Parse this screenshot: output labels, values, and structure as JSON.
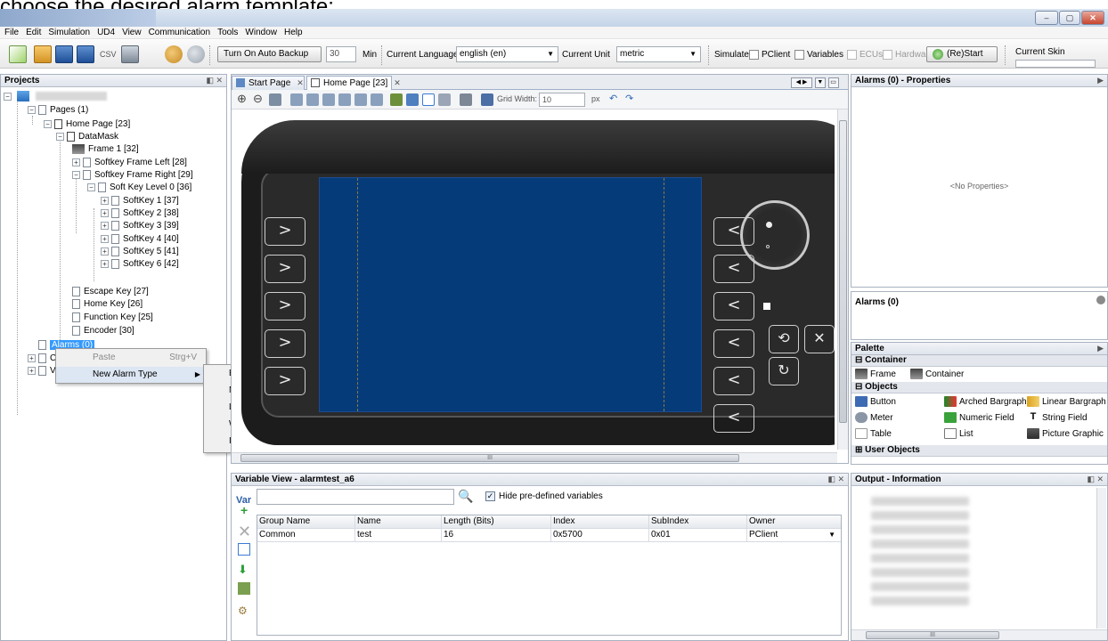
{
  "caption": "choose the desired alarm template:",
  "window": {
    "minimize": "–",
    "maximize": "▢",
    "close": "✕"
  },
  "menu": [
    "File",
    "Edit",
    "Simulation",
    "UD4",
    "View",
    "Communication",
    "Tools",
    "Window",
    "Help"
  ],
  "toolbar": {
    "csv_label": "CSV",
    "auto_backup_button": "Turn On Auto Backup",
    "backup_minutes": "30",
    "min_label": "Min",
    "language_label": "Current Language",
    "language_value": "english (en)",
    "unit_label": "Current Unit",
    "unit_value": "metric",
    "simulate_label": "Simulate:",
    "pclient": "PClient",
    "variables": "Variables",
    "ecus": "ECUs",
    "hardware": "Hardware",
    "restart_button": "(Re)Start",
    "skin_label": "Current Skin"
  },
  "projects": {
    "title": "Projects",
    "controls": "◧ ✕",
    "tree": [
      {
        "label": "Pages (1)"
      },
      {
        "label": "Home Page [23]"
      },
      {
        "label": "DataMask"
      },
      {
        "label": "Frame 1 [32]"
      },
      {
        "label": "Softkey Frame Left [28]"
      },
      {
        "label": "Softkey Frame Right [29]"
      },
      {
        "label": "Soft Key Level 0 [36]"
      },
      {
        "label": "SoftKey 1 [37]"
      },
      {
        "label": "SoftKey 2 [38]"
      },
      {
        "label": "SoftKey 3 [39]"
      },
      {
        "label": "SoftKey 4 [40]"
      },
      {
        "label": "SoftKey 5 [41]"
      },
      {
        "label": "SoftKey 6 [42]"
      },
      {
        "label": "Escape Key [27]"
      },
      {
        "label": "Home Key [26]"
      },
      {
        "label": "Function Key [25]"
      },
      {
        "label": "Encoder [30]"
      },
      {
        "label": "Alarms (0)"
      },
      {
        "label": "Co"
      },
      {
        "label": "Vir"
      }
    ]
  },
  "context_menu": {
    "paste": "Paste",
    "paste_shortcut": "Strg+V",
    "new_alarm_type": "New Alarm Type",
    "submenu": [
      "Emergency",
      "Med",
      "Low",
      "Warning",
      "Informational"
    ]
  },
  "editor": {
    "tabs": [
      {
        "label": "Start Page"
      },
      {
        "label": "Home Page [23]"
      }
    ],
    "tab_close": "✕",
    "grid_width_label": "Grid Width:",
    "grid_width_value": "10",
    "grid_unit": "px",
    "scroll_marker": "III"
  },
  "softkeys": {
    "right_glyph": ">",
    "left_glyph": "<"
  },
  "variable_view": {
    "title": "Variable View - alarmtest_a6",
    "controls": "◧ ✕",
    "var_label": "Var",
    "hide_predefined": "Hide pre-defined variables",
    "columns": [
      "Group Name",
      "Name",
      "Length (Bits)",
      "Index",
      "SubIndex",
      "Owner"
    ],
    "rows": [
      [
        "Common",
        "test",
        "16",
        "0x5700",
        "0x01",
        "PClient"
      ]
    ]
  },
  "properties": {
    "title": "Alarms (0) - Properties",
    "empty": "<No Properties>"
  },
  "alarms": {
    "title": "Alarms (0)"
  },
  "palette": {
    "title": "Palette",
    "sections": {
      "container": "Container",
      "objects": "Objects",
      "user_objects": "User Objects"
    },
    "container_items": [
      "Frame",
      "Container"
    ],
    "object_items": [
      "Button",
      "Arched Bargraph",
      "Linear Bargraph",
      "Meter",
      "Numeric Field",
      "String Field",
      "Table",
      "List",
      "Picture Graphic"
    ]
  },
  "output": {
    "title": "Output - Information",
    "scroll_marker": "III"
  },
  "colors": {
    "screen": "#063b7a",
    "device": "#1c1c1c",
    "selection": "#3399ff"
  }
}
